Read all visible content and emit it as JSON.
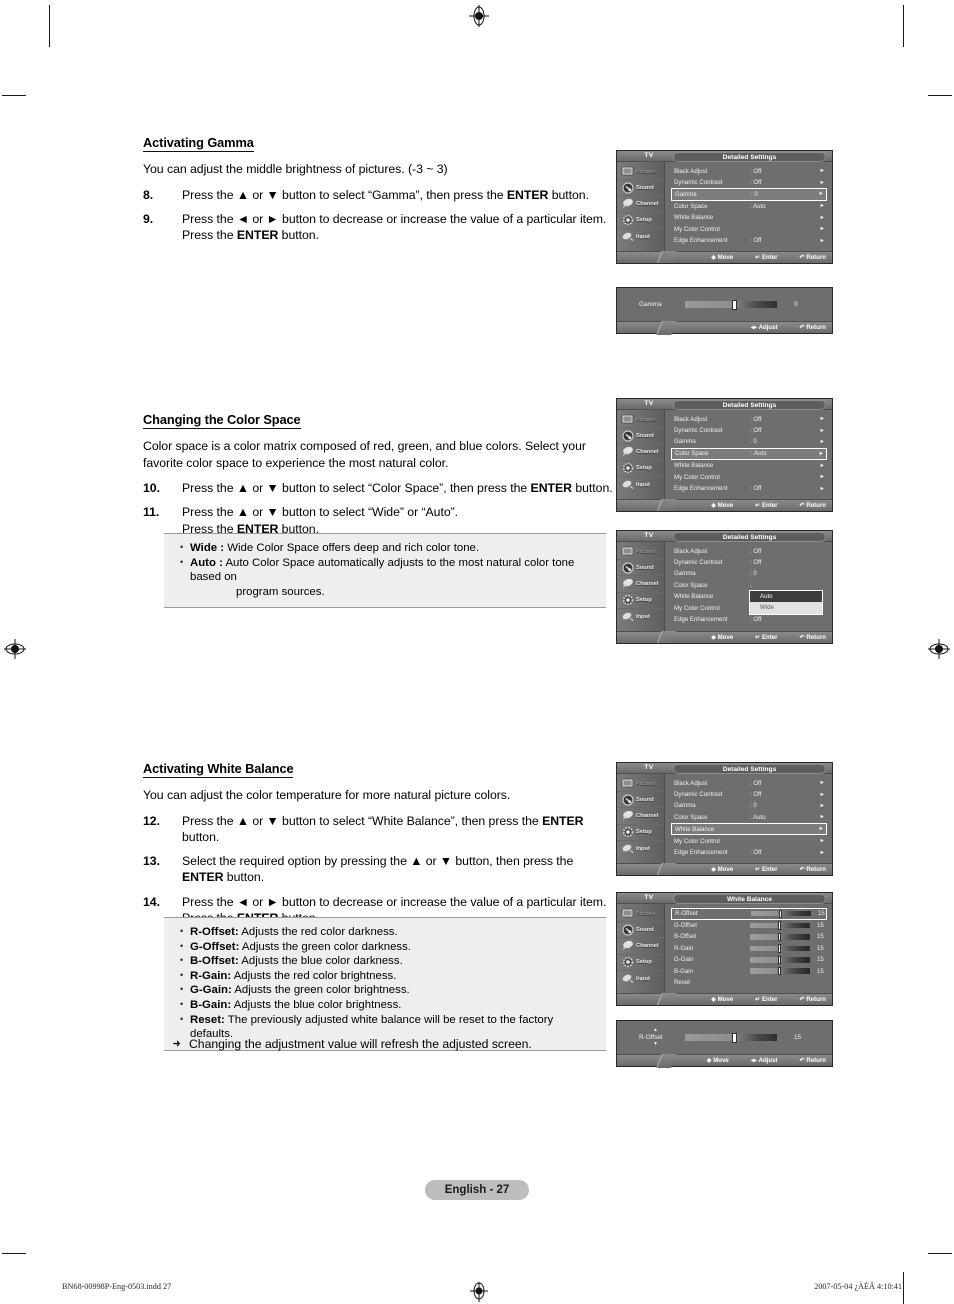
{
  "page": {
    "number_label": "English - 27",
    "footer_left": "BN68-00998P-Eng-0503.indd   27",
    "footer_right": "2007-05-04   ¿ÀÈÄ 4:10:41"
  },
  "sections": [
    {
      "id": "gamma",
      "title": "Activating Gamma",
      "intro": "You can adjust the middle brightness of pictures. (-3 ~ 3)",
      "steps": [
        {
          "num": "8.",
          "html": "Press the ▲ or ▼ button to select “Gamma”, then press the <b>ENTER</b> button."
        },
        {
          "num": "9.",
          "html": "Press the ◄ or ► button to decrease or increase the value of a particular item. Press the <b>ENTER</b> button."
        }
      ]
    },
    {
      "id": "color-space",
      "title": "Changing the Color Space",
      "intro": "Color space is a color matrix composed of red, green, and blue colors. Select your favorite color space to experience the most natural color.",
      "steps": [
        {
          "num": "10.",
          "html": "Press the ▲ or ▼ button to select “Color Space”, then press the <b>ENTER</b> button."
        },
        {
          "num": "11.",
          "html": "Press the ▲ or ▼ button to select “Wide” or “Auto”.<br>Press the <b>ENTER</b> button."
        }
      ],
      "note": [
        {
          "term": "Wide :",
          "desc": "Wide Color Space offers deep and rich color tone."
        },
        {
          "term": "Auto :",
          "desc": "Auto Color Space automatically adjusts to the most natural color tone based on",
          "cont": "program sources."
        }
      ]
    },
    {
      "id": "white-balance",
      "title": "Activating White Balance",
      "intro": "You can adjust the color temperature for more natural picture colors.",
      "steps": [
        {
          "num": "12.",
          "html": "Press the ▲ or ▼ button to select “White Balance”, then press the <b>ENTER</b> button."
        },
        {
          "num": "13.",
          "html": "Select the required option by pressing the ▲ or ▼ button, then press the <b>ENTER</b> button."
        },
        {
          "num": "14.",
          "html": "Press the ◄ or ► button to decrease or increase the value of a particular item. Press the <b>ENTER</b> button."
        }
      ],
      "note": [
        {
          "term": "R-Offset:",
          "desc": "Adjusts the red color darkness."
        },
        {
          "term": "G-Offset:",
          "desc": "Adjusts the green color darkness."
        },
        {
          "term": "B-Offset:",
          "desc": "Adjusts the blue color darkness."
        },
        {
          "term": "R-Gain:",
          "desc": "Adjusts the red color brightness."
        },
        {
          "term": "G-Gain:",
          "desc": "Adjusts the green color brightness."
        },
        {
          "term": "B-Gain:",
          "desc": "Adjusts the blue color brightness."
        },
        {
          "term": "Reset:",
          "desc": "The previously adjusted white balance will be reset to the factory defaults."
        }
      ],
      "tip": "Changing the adjustment value will refresh the adjusted screen."
    }
  ],
  "osd": {
    "tv_label": "TV",
    "title_detailed": "Detailed Settings",
    "title_white_balance": "White Balance",
    "sidebar": [
      {
        "label": "Picture",
        "icon": "picture-icon",
        "dim": true
      },
      {
        "label": "Sound",
        "icon": "sound-icon",
        "dim": false
      },
      {
        "label": "Channel",
        "icon": "channel-icon",
        "dim": false
      },
      {
        "label": "Setup",
        "icon": "setup-icon",
        "dim": false
      },
      {
        "label": "Input",
        "icon": "input-icon",
        "dim": false
      }
    ],
    "footer": {
      "move": "Move",
      "enter": "Enter",
      "return": "Return",
      "adjust": "Adjust"
    },
    "detailed_items": [
      {
        "label": "Black Adjust",
        "value": ": Off"
      },
      {
        "label": "Dynamic Contrast",
        "value": ": Off"
      },
      {
        "label": "Gamma",
        "value": ": 0"
      },
      {
        "label": "Color Space",
        "value": ": Auto"
      },
      {
        "label": "White Balance",
        "value": ""
      },
      {
        "label": "My Color Control",
        "value": ""
      },
      {
        "label": "Edge Enhancement",
        "value": ": Off"
      }
    ],
    "color_space_options": [
      {
        "label": "Auto",
        "selected": true
      },
      {
        "label": "Wide",
        "selected": false
      }
    ],
    "white_balance_items": [
      {
        "label": "R-Offset",
        "value": "15"
      },
      {
        "label": "G-Offset",
        "value": "15"
      },
      {
        "label": "B-Offset",
        "value": "15"
      },
      {
        "label": "R-Gain",
        "value": "15"
      },
      {
        "label": "G-Gain",
        "value": "15"
      },
      {
        "label": "B-Gain",
        "value": "15"
      },
      {
        "label": "Reset",
        "value": ""
      }
    ],
    "gamma_slider": {
      "label": "Gamma",
      "value": "0"
    },
    "roffset_slider": {
      "label": "R-Offset",
      "value": "15"
    }
  }
}
